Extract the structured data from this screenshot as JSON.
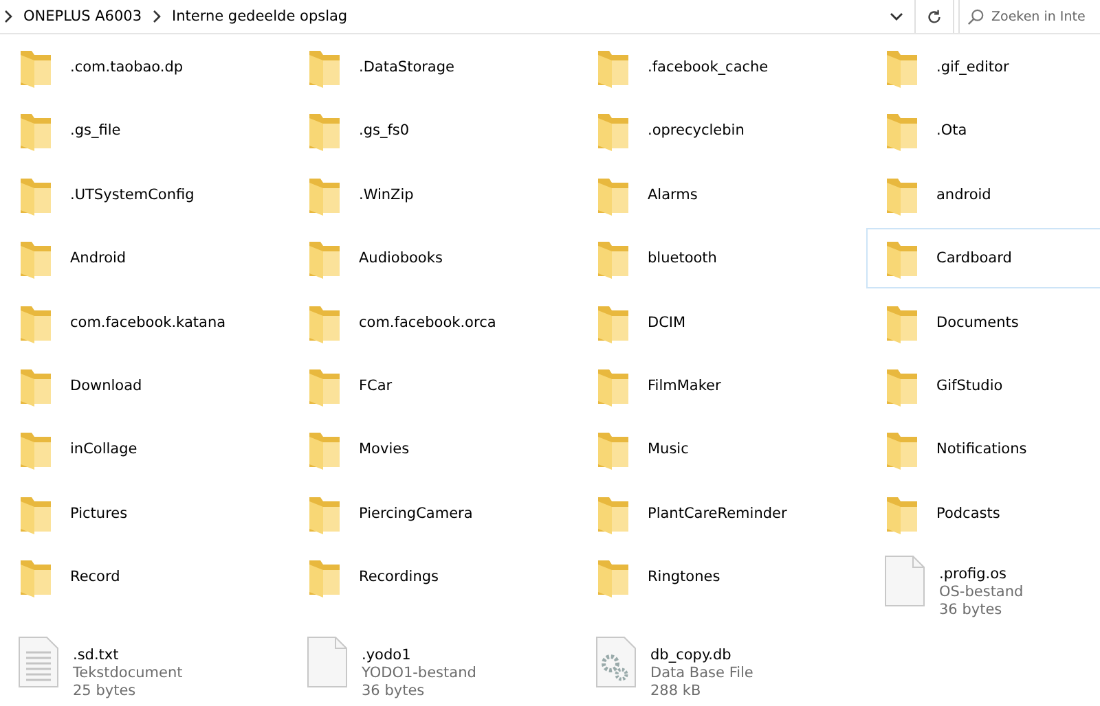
{
  "address_bar": {
    "path": [
      {
        "label": "ONEPLUS A6003"
      },
      {
        "label": "Interne gedeelde opslag"
      }
    ]
  },
  "search": {
    "placeholder": "Zoeken in Inte"
  },
  "items": [
    {
      "kind": "folder",
      "name": ".com.taobao.dp",
      "hovered": false
    },
    {
      "kind": "folder",
      "name": ".DataStorage",
      "hovered": false
    },
    {
      "kind": "folder",
      "name": ".facebook_cache",
      "hovered": false
    },
    {
      "kind": "folder",
      "name": ".gif_editor",
      "hovered": false
    },
    {
      "kind": "folder",
      "name": ".gs_file",
      "hovered": false
    },
    {
      "kind": "folder",
      "name": ".gs_fs0",
      "hovered": false
    },
    {
      "kind": "folder",
      "name": ".oprecyclebin",
      "hovered": false
    },
    {
      "kind": "folder",
      "name": ".Ota",
      "hovered": false
    },
    {
      "kind": "folder",
      "name": ".UTSystemConfig",
      "hovered": false
    },
    {
      "kind": "folder",
      "name": ".WinZip",
      "hovered": false
    },
    {
      "kind": "folder",
      "name": "Alarms",
      "hovered": false
    },
    {
      "kind": "folder",
      "name": "android",
      "hovered": false
    },
    {
      "kind": "folder",
      "name": "Android",
      "hovered": false
    },
    {
      "kind": "folder",
      "name": "Audiobooks",
      "hovered": false
    },
    {
      "kind": "folder",
      "name": "bluetooth",
      "hovered": false
    },
    {
      "kind": "folder",
      "name": "Cardboard",
      "hovered": true
    },
    {
      "kind": "folder",
      "name": "com.facebook.katana",
      "hovered": false
    },
    {
      "kind": "folder",
      "name": "com.facebook.orca",
      "hovered": false
    },
    {
      "kind": "folder",
      "name": "DCIM",
      "hovered": false
    },
    {
      "kind": "folder",
      "name": "Documents",
      "hovered": false
    },
    {
      "kind": "folder",
      "name": "Download",
      "hovered": false
    },
    {
      "kind": "folder",
      "name": "FCar",
      "hovered": false
    },
    {
      "kind": "folder",
      "name": "FilmMaker",
      "hovered": false
    },
    {
      "kind": "folder",
      "name": "GifStudio",
      "hovered": false
    },
    {
      "kind": "folder",
      "name": "inCollage",
      "hovered": false
    },
    {
      "kind": "folder",
      "name": "Movies",
      "hovered": false
    },
    {
      "kind": "folder",
      "name": "Music",
      "hovered": false
    },
    {
      "kind": "folder",
      "name": "Notifications",
      "hovered": false
    },
    {
      "kind": "folder",
      "name": "Pictures",
      "hovered": false
    },
    {
      "kind": "folder",
      "name": "PiercingCamera",
      "hovered": false
    },
    {
      "kind": "folder",
      "name": "PlantCareReminder",
      "hovered": false
    },
    {
      "kind": "folder",
      "name": "Podcasts",
      "hovered": false
    },
    {
      "kind": "folder",
      "name": "Record",
      "hovered": false
    },
    {
      "kind": "folder",
      "name": "Recordings",
      "hovered": false
    },
    {
      "kind": "folder",
      "name": "Ringtones",
      "hovered": false
    },
    {
      "kind": "blank-file",
      "name": ".profig.os",
      "type": "OS-bestand",
      "size": "36 bytes",
      "hovered": false
    },
    {
      "kind": "text-file",
      "name": ".sd.txt",
      "type": "Tekstdocument",
      "size": "25 bytes",
      "hovered": false
    },
    {
      "kind": "blank-file",
      "name": ".yodo1",
      "type": "YODO1-bestand",
      "size": "36 bytes",
      "hovered": false
    },
    {
      "kind": "data-file",
      "name": "db_copy.db",
      "type": "Data Base File",
      "size": "288 kB",
      "hovered": false
    }
  ]
}
